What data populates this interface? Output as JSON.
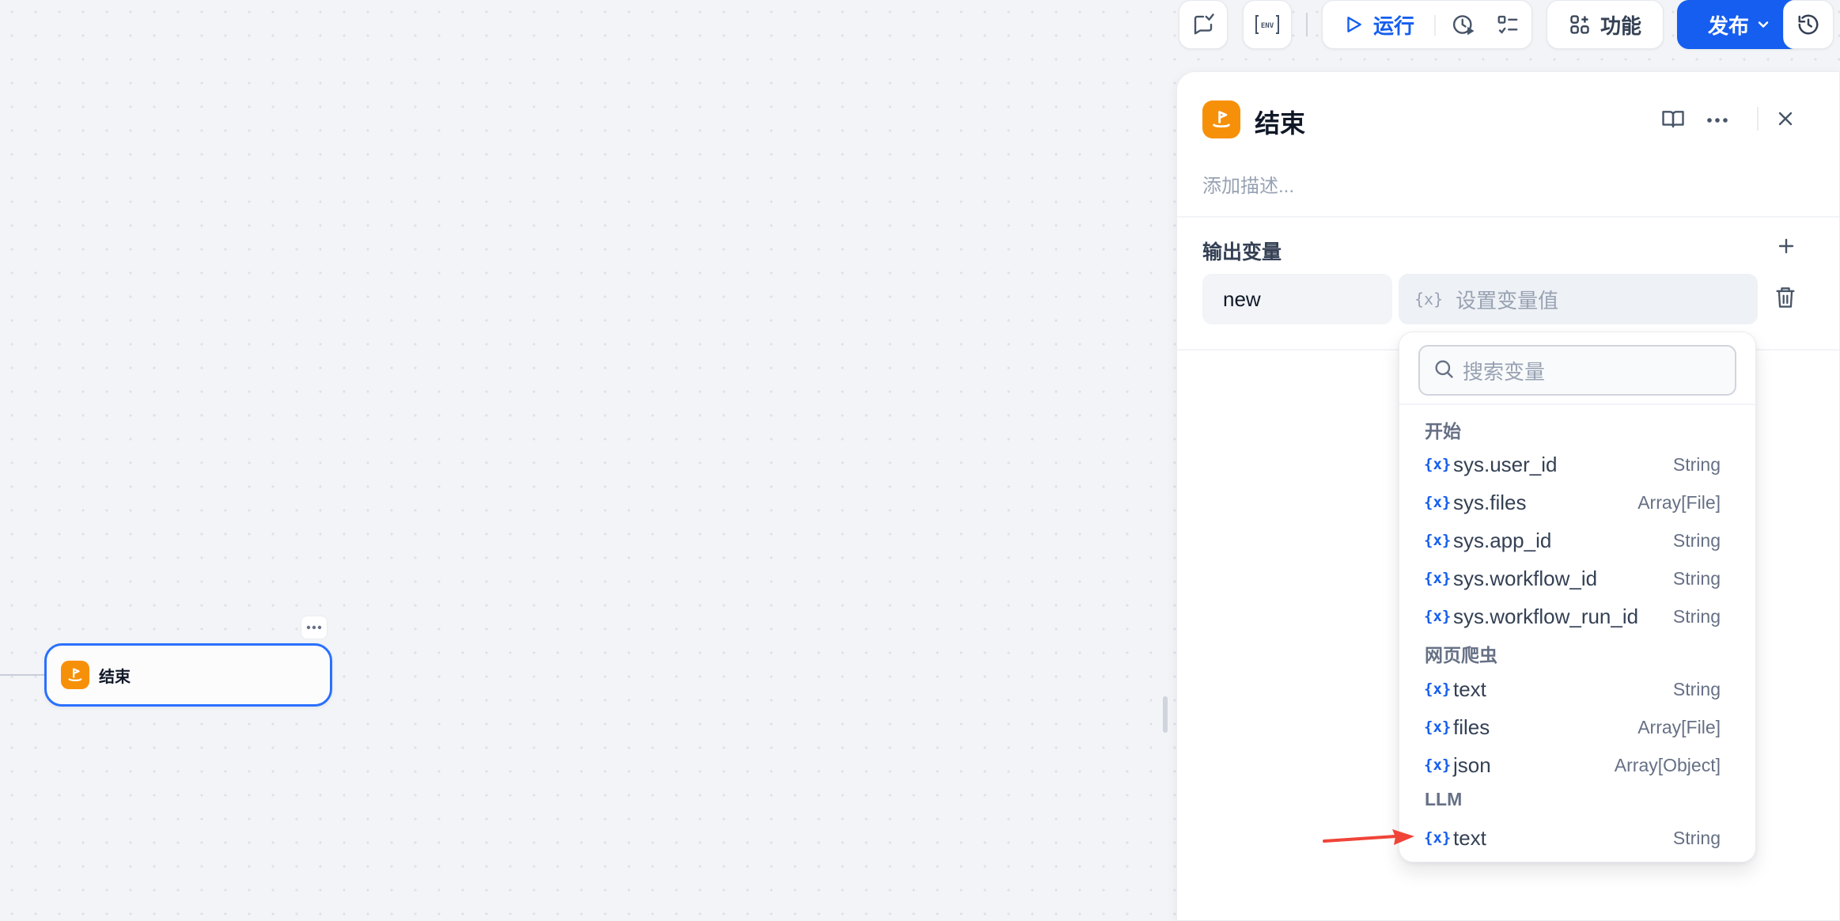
{
  "toolbar": {
    "feature_toggle_icon": "comment-check-icon",
    "env_icon": "env-icon",
    "run_label": "运行",
    "history_icon": "clock-play-icon",
    "checklist_icon": "checklist-icon",
    "features_label": "功能",
    "publish_label": "发布",
    "version_history_icon": "history-icon"
  },
  "canvas": {
    "node": {
      "title": "结束",
      "icon": "end-icon"
    }
  },
  "panel": {
    "title": "结束",
    "description_placeholder": "添加描述...",
    "output_section_title": "输出变量",
    "variable": {
      "name": "new",
      "value_placeholder": "设置变量值"
    }
  },
  "dropdown": {
    "search_placeholder": "搜索变量",
    "groups": [
      {
        "title": "开始",
        "items": [
          {
            "name": "sys.user_id",
            "type": "String"
          },
          {
            "name": "sys.files",
            "type": "Array[File]"
          },
          {
            "name": "sys.app_id",
            "type": "String"
          },
          {
            "name": "sys.workflow_id",
            "type": "String"
          },
          {
            "name": "sys.workflow_run_id",
            "type": "String"
          }
        ]
      },
      {
        "title": "网页爬虫",
        "items": [
          {
            "name": "text",
            "type": "String"
          },
          {
            "name": "files",
            "type": "Array[File]"
          },
          {
            "name": "json",
            "type": "Array[Object]"
          }
        ]
      },
      {
        "title": "LLM",
        "items": [
          {
            "name": "text",
            "type": "String"
          }
        ]
      }
    ],
    "var_icon_glyph": "{x}"
  },
  "colors": {
    "accent": "#155eef",
    "node_icon": "#f79009",
    "arrow": "#f04438"
  }
}
